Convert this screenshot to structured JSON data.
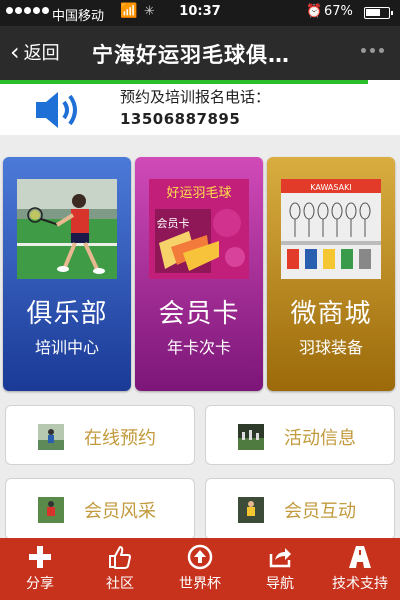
{
  "status": {
    "carrier": "中国移动",
    "time": "10:37",
    "battery": "67%",
    "battery_level": 0.67
  },
  "nav": {
    "back_label": "返回",
    "title": "宁海好运羽毛球俱…"
  },
  "page_load_progress": 0.92,
  "contact": {
    "label": "预约及培训报名电话：",
    "phone": "13506887895"
  },
  "cards": [
    {
      "title": "俱乐部",
      "subtitle": "培训中心"
    },
    {
      "title": "会员卡",
      "subtitle": "年卡次卡",
      "image_text": {
        "top": "好运羽毛球",
        "card": "会员卡"
      }
    },
    {
      "title": "微商城",
      "subtitle": "羽球装备",
      "image_text": {
        "brand": "KAWASAKI"
      }
    }
  ],
  "buttons": [
    {
      "label": "在线预约"
    },
    {
      "label": "活动信息"
    },
    {
      "label": "会员风采"
    },
    {
      "label": "会员互动"
    }
  ],
  "tabs": [
    {
      "label": "分享",
      "icon": "plus-icon"
    },
    {
      "label": "社区",
      "icon": "thumbs-up-icon"
    },
    {
      "label": "世界杯",
      "icon": "arrow-up-circle-icon"
    },
    {
      "label": "导航",
      "icon": "share-arrow-icon"
    },
    {
      "label": "技术支持",
      "icon": "road-a-icon"
    }
  ],
  "colors": {
    "nav_bg": "#2b2b2b",
    "tab_bar": "#c7321d",
    "button_text": "#c29a3c",
    "progress": "#2bbd2b",
    "speaker_icon": "#1e6fd6"
  }
}
